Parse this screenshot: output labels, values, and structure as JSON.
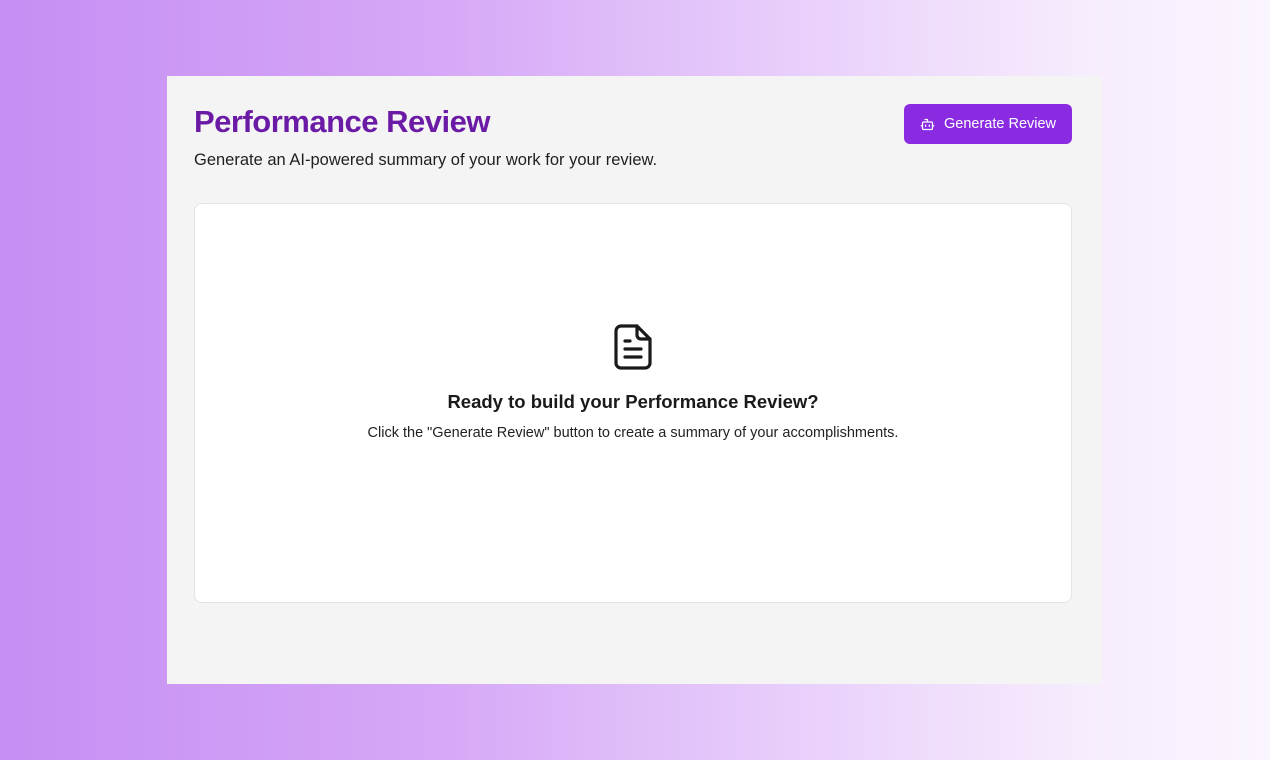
{
  "header": {
    "title": "Performance Review",
    "subtitle": "Generate an AI-powered summary of your work for your review."
  },
  "toolbar": {
    "generate_label": "Generate Review",
    "generate_icon": "bot-icon"
  },
  "empty_state": {
    "icon": "document-icon",
    "title": "Ready to build your Performance Review?",
    "text": "Click the \"Generate Review\" button to create a summary of your accomplishments."
  },
  "colors": {
    "accent": "#8a2be2",
    "title": "#6b1aa5",
    "panel": "#f4f4f4"
  }
}
